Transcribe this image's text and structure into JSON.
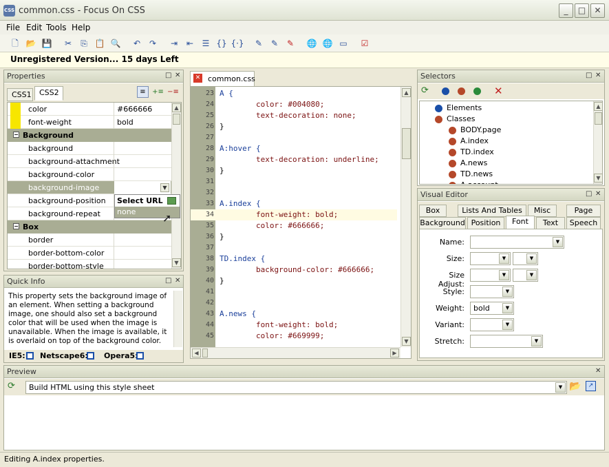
{
  "window": {
    "title": "common.css - Focus On CSS",
    "app_icon": "CSS"
  },
  "menu": [
    "File",
    "Edit",
    "Tools",
    "Help"
  ],
  "nag": {
    "text": "Unregistered Version...  15 days Left"
  },
  "properties": {
    "title": "Properties",
    "tabs": [
      "CSS1",
      "CSS2"
    ],
    "rows_top": [
      {
        "key": "color",
        "value": "#666666"
      },
      {
        "key": "font-weight",
        "value": "bold"
      }
    ],
    "section_background": "Background",
    "rows_background": [
      {
        "key": "background",
        "value": ""
      },
      {
        "key": "background-attachment",
        "value": ""
      },
      {
        "key": "background-color",
        "value": ""
      },
      {
        "key": "background-image",
        "value": ""
      },
      {
        "key": "background-position",
        "value": ""
      },
      {
        "key": "background-repeat",
        "value": ""
      }
    ],
    "section_box": "Box",
    "rows_box": [
      {
        "key": "border",
        "value": ""
      },
      {
        "key": "border-bottom-color",
        "value": ""
      },
      {
        "key": "border-bottom-style",
        "value": ""
      }
    ],
    "popup": {
      "header": "Select URL",
      "option": "none"
    }
  },
  "quick_info": {
    "title": "Quick Info",
    "text": "This property sets the background image of an element. When setting a background image, one should also set a background color that will be used when the image is unavailable. When the image is available, it is overlaid on top of the background color.",
    "browsers": [
      "IE5:",
      "Netscape6:",
      "Opera5:"
    ]
  },
  "editor": {
    "tab": "common.css",
    "lines": [
      {
        "n": "23",
        "t": "A {",
        "hl": false
      },
      {
        "n": "24",
        "t": "        color: #004080;",
        "hl": false
      },
      {
        "n": "25",
        "t": "        text-decoration: none;",
        "hl": false
      },
      {
        "n": "26",
        "t": "}",
        "hl": false
      },
      {
        "n": "27",
        "t": "",
        "hl": false
      },
      {
        "n": "28",
        "t": "A:hover {",
        "hl": false
      },
      {
        "n": "29",
        "t": "        text-decoration: underline;",
        "hl": false
      },
      {
        "n": "30",
        "t": "}",
        "hl": false
      },
      {
        "n": "31",
        "t": "",
        "hl": false
      },
      {
        "n": "32",
        "t": "",
        "hl": false
      },
      {
        "n": "33",
        "t": "A.index {",
        "hl": false
      },
      {
        "n": "34",
        "t": "        font-weight: bold;",
        "hl": true
      },
      {
        "n": "35",
        "t": "        color: #666666;",
        "hl": false
      },
      {
        "n": "36",
        "t": "}",
        "hl": false
      },
      {
        "n": "37",
        "t": "",
        "hl": false
      },
      {
        "n": "38",
        "t": "TD.index {",
        "hl": false
      },
      {
        "n": "39",
        "t": "        background-color: #666666;",
        "hl": false
      },
      {
        "n": "40",
        "t": "}",
        "hl": false
      },
      {
        "n": "41",
        "t": "",
        "hl": false
      },
      {
        "n": "42",
        "t": "",
        "hl": false
      },
      {
        "n": "43",
        "t": "A.news {",
        "hl": false
      },
      {
        "n": "44",
        "t": "        font-weight: bold;",
        "hl": false
      },
      {
        "n": "45",
        "t": "        color: #669999;",
        "hl": false
      }
    ]
  },
  "selectors": {
    "title": "Selectors",
    "tree": [
      {
        "label": "Elements",
        "color": "#1a4fa8",
        "level": 0
      },
      {
        "label": "Classes",
        "color": "#b5482a",
        "level": 0
      },
      {
        "label": "BODY.page",
        "color": "#b5482a",
        "level": 1
      },
      {
        "label": "A.index",
        "color": "#b5482a",
        "level": 1
      },
      {
        "label": "TD.index",
        "color": "#b5482a",
        "level": 1
      },
      {
        "label": "A.news",
        "color": "#b5482a",
        "level": 1
      },
      {
        "label": "TD.news",
        "color": "#b5482a",
        "level": 1
      },
      {
        "label": "A.account",
        "color": "#b5482a",
        "level": 1
      }
    ]
  },
  "visual_editor": {
    "title": "Visual Editor",
    "tabs_row1": [
      "Box",
      "Lists And Tables",
      "Misc",
      "Page"
    ],
    "tabs_row2": [
      "Background",
      "Position",
      "Font",
      "Text",
      "Speech"
    ],
    "active_tab": "Font",
    "fields": {
      "name": "Name:",
      "size": "Size:",
      "size_adjust": "Size Adjust:",
      "style": "Style:",
      "weight": "Weight:",
      "weight_value": "bold",
      "variant": "Variant:",
      "stretch": "Stretch:"
    }
  },
  "preview": {
    "title": "Preview",
    "build_label": "Build HTML using this style sheet"
  },
  "status": {
    "text": "Editing A.index properties."
  },
  "colors": {
    "accent_yellow": "#f7e600",
    "section_bg": "#a9ad94"
  }
}
